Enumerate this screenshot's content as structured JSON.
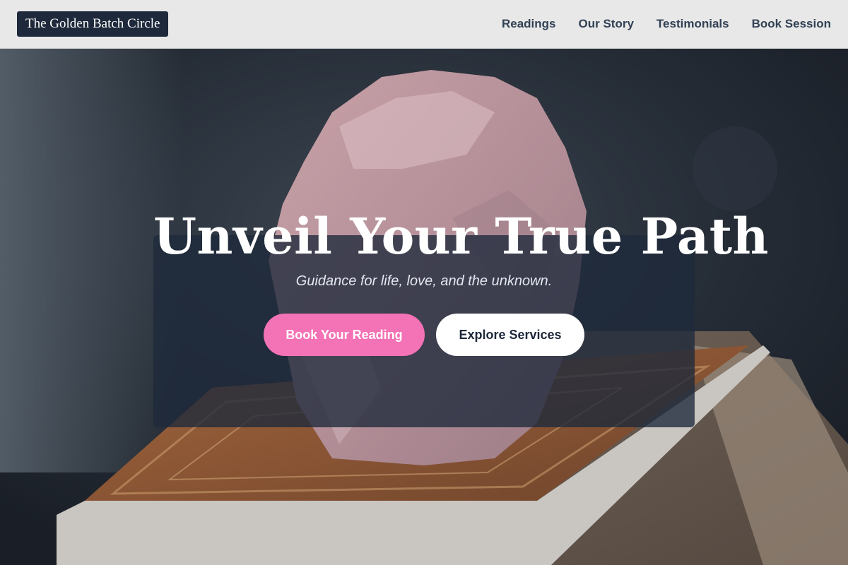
{
  "header": {
    "brand": "The Golden Batch Circle",
    "nav": [
      {
        "label": "Readings"
      },
      {
        "label": "Our Story"
      },
      {
        "label": "Testimonials"
      },
      {
        "label": "Book Session"
      }
    ]
  },
  "hero": {
    "background": "rose quartz crystal on a tarot deck",
    "headline": "Unveil Your True Path",
    "subheadline": "Guidance for life, love, and the unknown.",
    "primary_cta": "Book Your Reading",
    "secondary_cta": "Explore Services"
  },
  "colors": {
    "header_bg": "#e8e8e8",
    "brand_bg": "#1e293b",
    "nav_text": "#334155",
    "card_bg": "#1e293b",
    "primary_cta": "#f472b6",
    "secondary_cta": "#ffffff"
  }
}
